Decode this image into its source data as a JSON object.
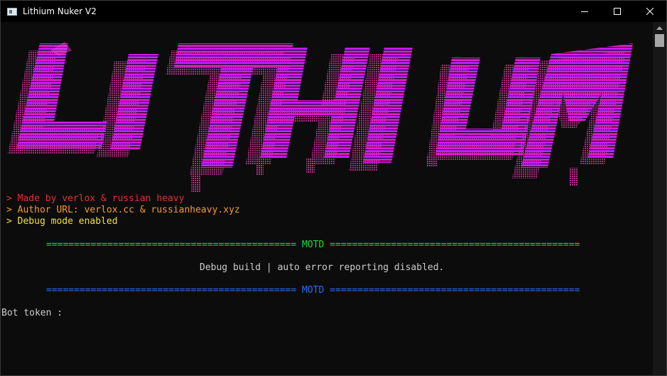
{
  "window": {
    "title": "Lithium Nuker V2"
  },
  "colors": {
    "console_bg": "#0c0c0c",
    "banner_top": "#9b1bff",
    "banner_bottom": "#ff17c8",
    "banner_shadow": "#c3338f",
    "red": "#e0303a",
    "orange": "#f39a2a",
    "yellow": "#f0e13a",
    "motd_green": "#1fd93a",
    "motd_blue": "#2a6cf7"
  },
  "banner": {
    "text": "LITHIUM",
    "icon": "ascii-art-logo"
  },
  "console": {
    "made_by": "> Made by verlox & russian heavy",
    "author_url": "> Author URL: verlox.cc & russianheavy.xyz",
    "debug_mode": "> Debug mode enabled",
    "motd_top_left": "=============================================",
    "motd_top_label": "MOTD",
    "motd_top_right": "=============================================",
    "motd_message": "Debug build | auto error reporting disabled.",
    "motd_bottom_left": "=============================================",
    "motd_bottom_label": "MOTD",
    "motd_bottom_right": "=============================================",
    "prompt": "Bot token :"
  }
}
